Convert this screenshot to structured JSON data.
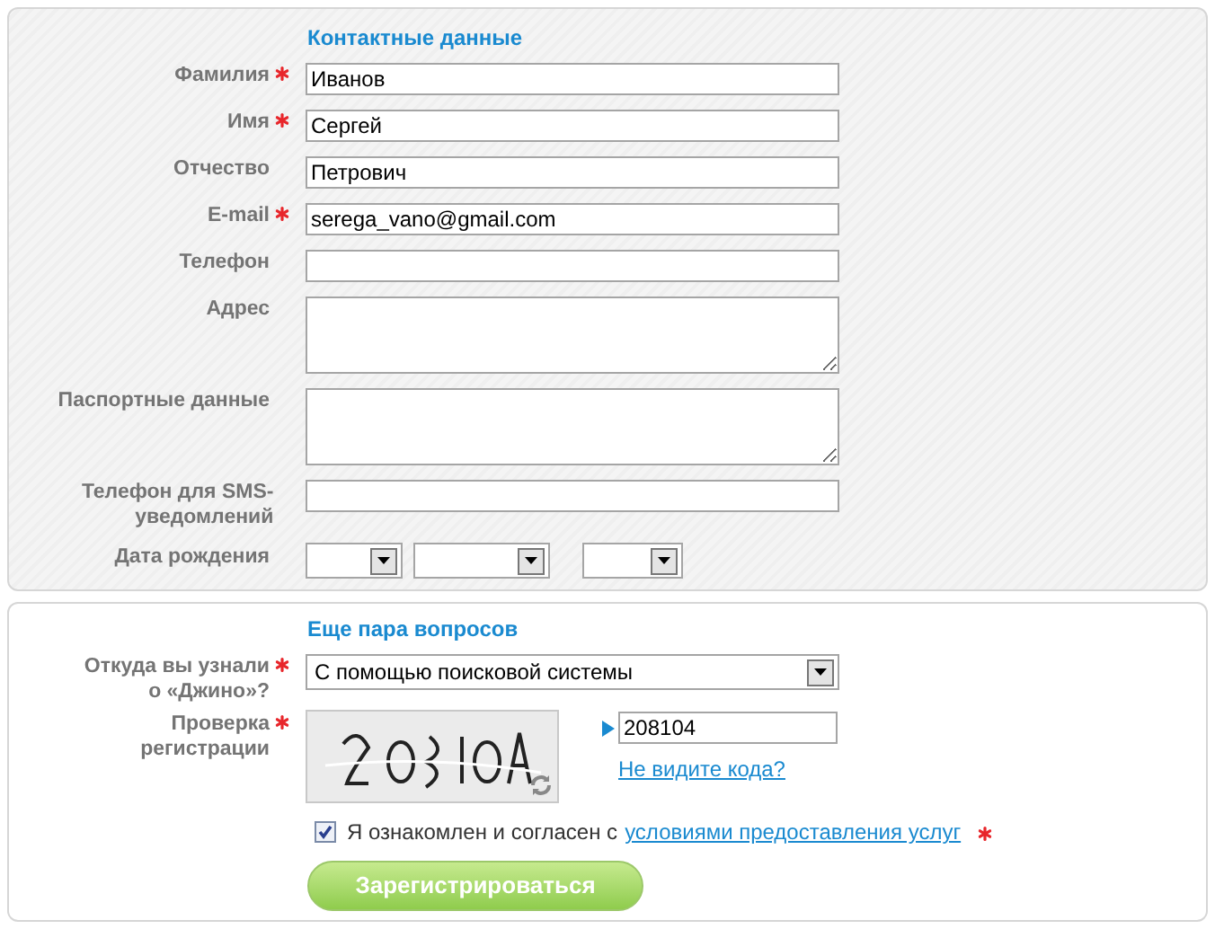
{
  "contact": {
    "title": "Контактные данные",
    "fields": [
      {
        "kind": "text",
        "label": "Фамилия",
        "required": true,
        "value": "Иванов"
      },
      {
        "kind": "text",
        "label": "Имя",
        "required": true,
        "value": "Сергей"
      },
      {
        "kind": "text",
        "label": "Отчество",
        "required": false,
        "value": "Петрович"
      },
      {
        "kind": "text",
        "label": "E-mail",
        "required": true,
        "value": "serega_vano@gmail.com"
      },
      {
        "kind": "text",
        "label": "Телефон",
        "required": false
      },
      {
        "kind": "textarea",
        "label": "Адрес",
        "required": false
      },
      {
        "kind": "textarea",
        "label": "Паспортные данные",
        "required": false
      },
      {
        "kind": "text",
        "label": "Телефон для SMS-уведомлений",
        "required": false
      },
      {
        "kind": "date",
        "label": "Дата рождения",
        "required": false,
        "parts": [
          {
            "kind": "day"
          },
          {
            "kind": "month"
          },
          {
            "kind": "year"
          }
        ]
      }
    ]
  },
  "questions": {
    "title": "Еще пара вопросов",
    "source": {
      "label": "Откуда вы узнали о «Джино»?",
      "required": true,
      "value": "С помощью поисковой системы"
    },
    "captcha": {
      "label": "Проверка регистрации",
      "required": true,
      "value": "208104",
      "link": "Не видите кода?"
    },
    "agreement": {
      "checked": true,
      "text": "Я ознакомлен и согласен с",
      "link": "условиями предоставления услуг",
      "required": true
    },
    "submit_button": "Зарегистрироваться"
  }
}
